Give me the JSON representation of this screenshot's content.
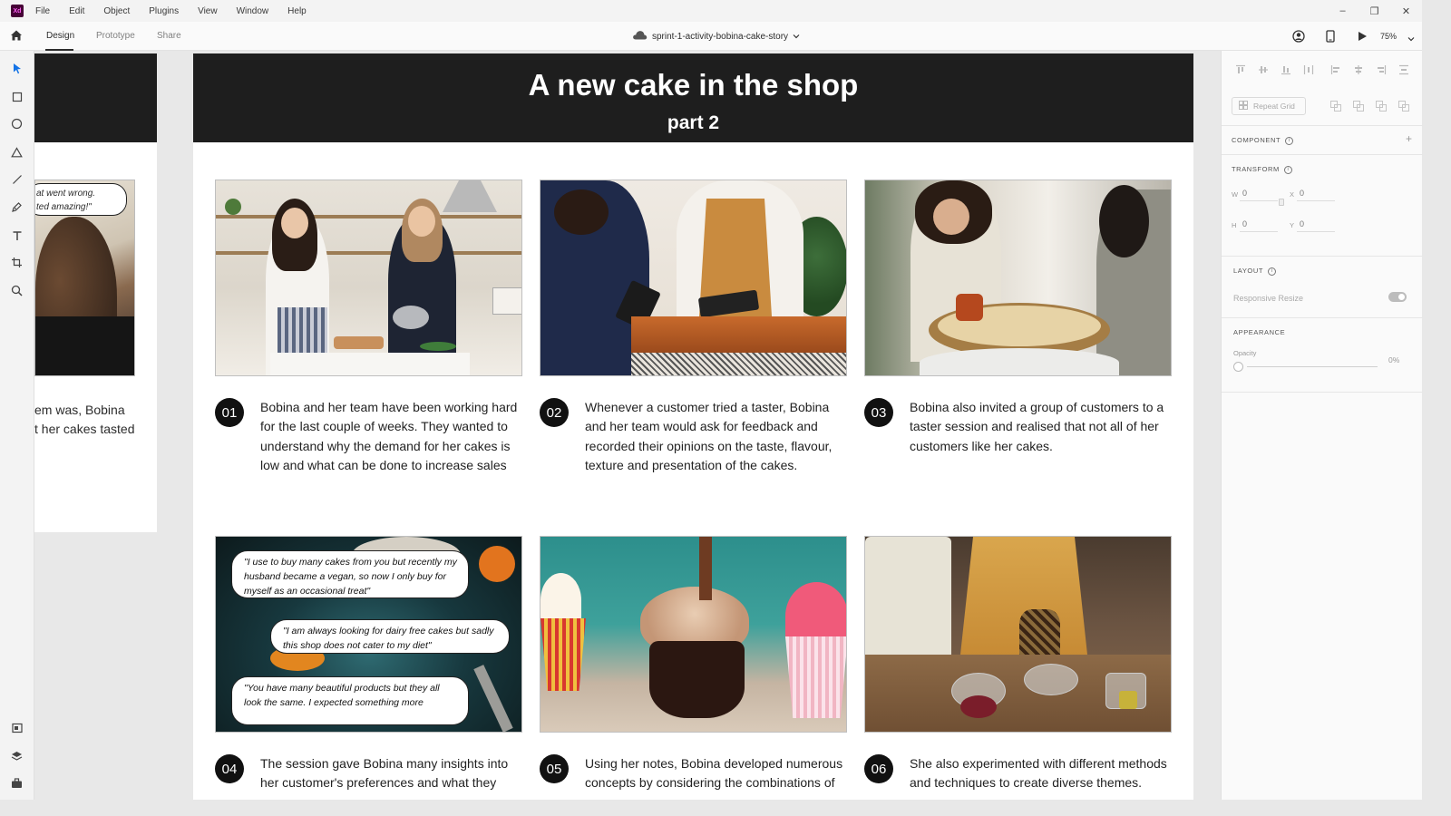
{
  "app": {
    "logo_text": "Xd"
  },
  "menu": [
    "File",
    "Edit",
    "Object",
    "Plugins",
    "View",
    "Window",
    "Help"
  ],
  "window_controls": {
    "minimize": "–",
    "restore": "❐",
    "close": "✕"
  },
  "toolbar": {
    "tabs": [
      "Design",
      "Prototype",
      "Share"
    ],
    "active_tab": "Design",
    "document_title": "sprint-1-activity-bobina-cake-story",
    "zoom": "75%"
  },
  "left_artboard": {
    "bubble_lines": [
      "at went wrong.",
      "ted amazing!\""
    ],
    "text_lines": [
      "em was, Bobina",
      "t her cakes tasted"
    ]
  },
  "artboard": {
    "title": "A new cake in the shop",
    "subtitle": "part 2",
    "steps": [
      {
        "number": "01",
        "text": "Bobina and her team have been working hard for the last couple of weeks. They wanted to understand why the demand for her cakes is low and what can be done to increase sales"
      },
      {
        "number": "02",
        "text": "Whenever a customer tried a taster, Bobina and her team would ask for feedback and recorded their opinions on the taste, flavour, texture and presentation of the cakes."
      },
      {
        "number": "03",
        "text": "Bobina also invited a group of customers to a taster session and realised that not all of her customers like her cakes."
      },
      {
        "number": "04",
        "text": "The session gave Bobina many insights into her customer's preferences and what they"
      },
      {
        "number": "05",
        "text": "Using her notes, Bobina developed numerous concepts by considering the combinations of"
      },
      {
        "number": "06",
        "text": "She also experimented with different methods and techniques to create diverse themes."
      }
    ],
    "quotes": [
      "\"I use to buy many cakes from you but recently my husband became a vegan, so now I only buy for myself as an occasional treat\"",
      "\"I am always looking for dairy free cakes but sadly this shop does not cater to my diet\"",
      "\"You have many beautiful products but they all look the same. I expected something more"
    ]
  },
  "panel": {
    "repeat_grid": "Repeat Grid",
    "component_label": "COMPONENT",
    "transform_label": "TRANSFORM",
    "w_label": "W",
    "w_value": "0",
    "h_label": "H",
    "h_value": "0",
    "x_label": "X",
    "x_value": "0",
    "y_label": "Y",
    "y_value": "0",
    "layout_label": "LAYOUT",
    "responsive_resize": "Responsive Resize",
    "appearance_label": "APPEARANCE",
    "opacity_label": "Opacity",
    "opacity_value": "0%"
  },
  "colors": {
    "artboard_header": "#1e1e1e",
    "xd_brand": "#470137",
    "xd_pink": "#ff61f6",
    "select_blue": "#1473e6"
  }
}
